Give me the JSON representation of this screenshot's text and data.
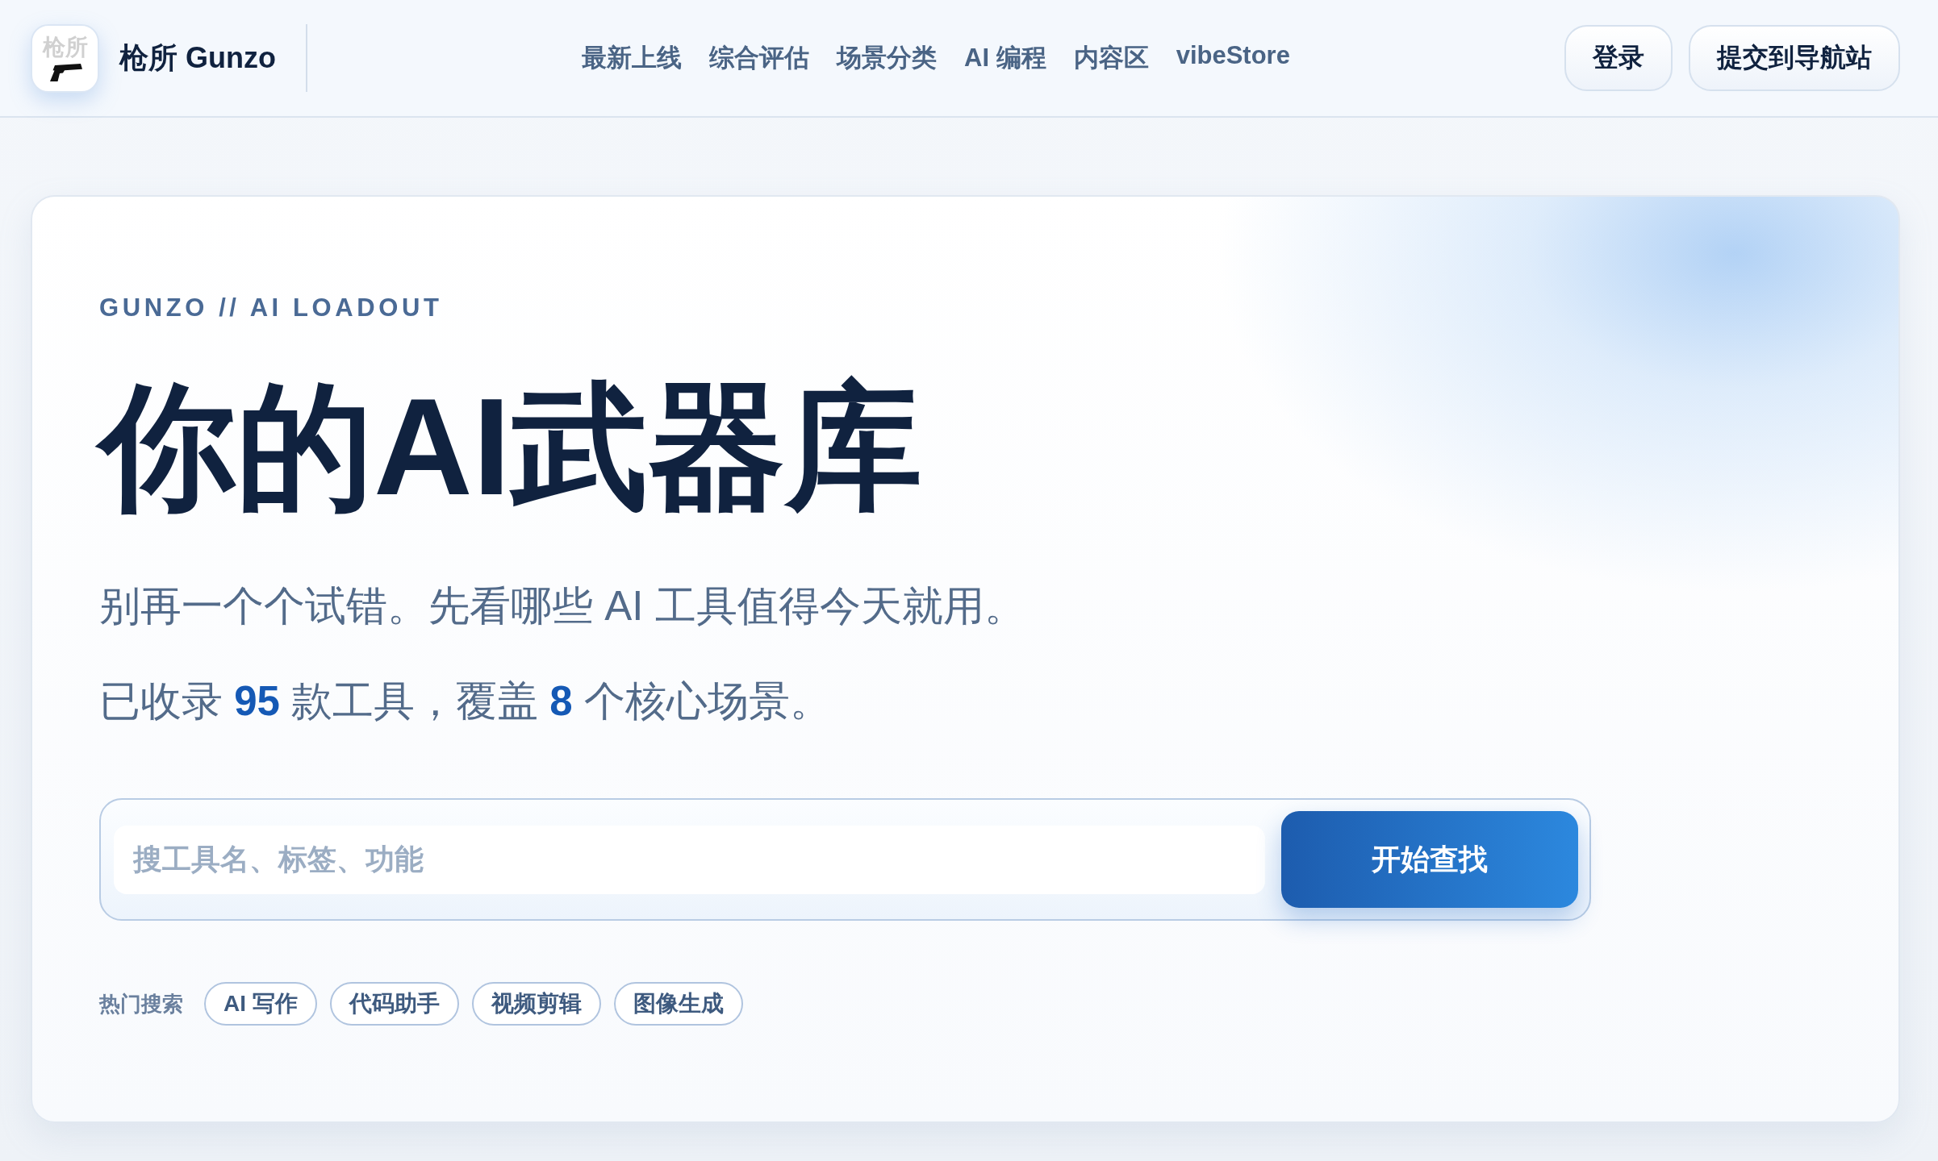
{
  "header": {
    "logo": {
      "text": "枪所"
    },
    "brand": "枪所 Gunzo",
    "nav": [
      "最新上线",
      "综合评估",
      "场景分类",
      "AI 编程",
      "内容区",
      "vibeStore"
    ],
    "actions": [
      "登录",
      "提交到导航站"
    ]
  },
  "hero": {
    "eyebrow": "GUNZO // AI LOADOUT",
    "title": "你的AI武器库",
    "subtitle": "别再一个个试错。先看哪些 AI 工具值得今天就用。",
    "stats": "已收录 **95** 款工具，覆盖 **8** 个核心场景。",
    "search": {
      "placeholder": "搜工具名、标签、功能",
      "button": "开始查找"
    },
    "hot_search": {
      "label": "热门搜索",
      "tags": [
        "AI 写作",
        "代码助手",
        "视频剪辑",
        "图像生成"
      ]
    }
  }
}
